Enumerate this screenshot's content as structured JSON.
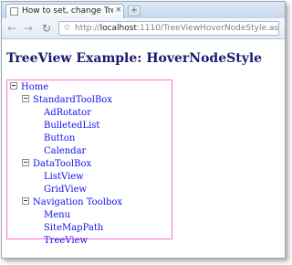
{
  "browser": {
    "tab_title": "How to set, change TreeVi...",
    "tab_close": "×",
    "new_tab": "+",
    "back_icon": "arrow-left-icon",
    "forward_icon": "arrow-right-icon",
    "reload_icon": "reload-icon",
    "star_icon": "star-icon",
    "url_scheme": "http://",
    "url_host": "localhost",
    "url_rest": ":1110/TreeViewHoverNodeStyle.aspx"
  },
  "page": {
    "title": "TreeView Example: HoverNodeStyle"
  },
  "tree": {
    "border_color": "#ff6fcf",
    "link_color": "#1010ee",
    "root": "Home",
    "groups": [
      {
        "label": "StandardToolBox",
        "children": [
          "AdRotator",
          "BulletedList",
          "Button",
          "Calendar"
        ]
      },
      {
        "label": "DataToolBox",
        "children": [
          "ListView",
          "GridView"
        ]
      },
      {
        "label": "Navigation Toolbox",
        "children": [
          "Menu",
          "SiteMapPath",
          "TreeView"
        ]
      }
    ]
  }
}
